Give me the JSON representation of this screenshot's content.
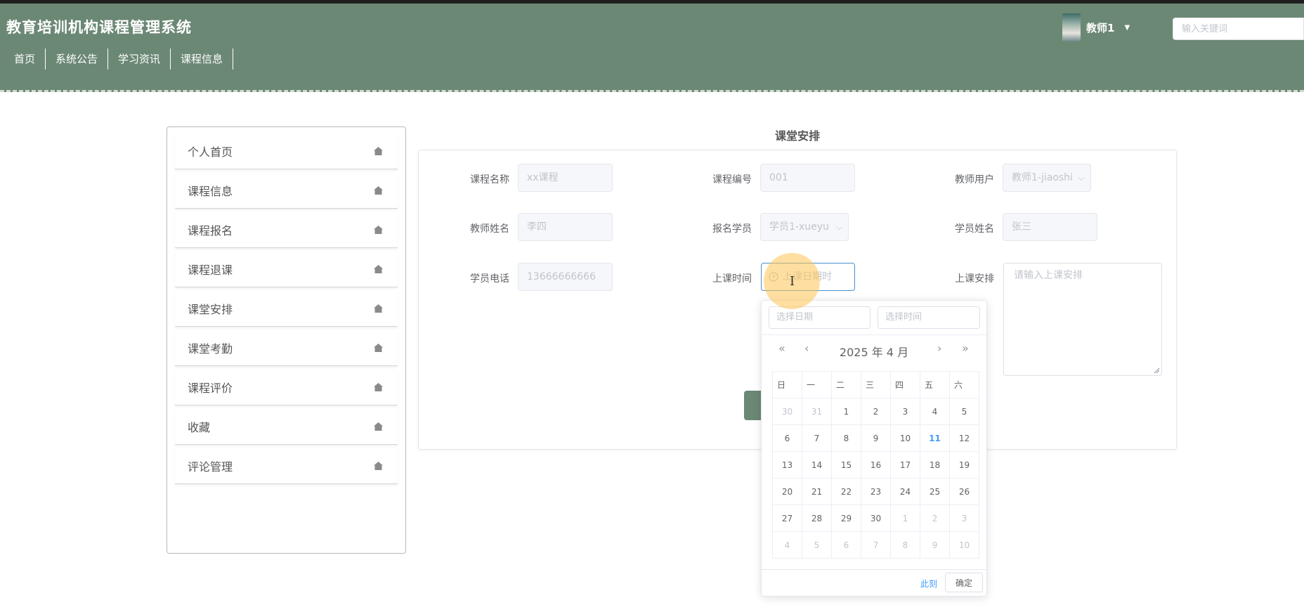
{
  "app": {
    "title": "教育培训机构课程管理系统"
  },
  "nav": [
    {
      "label": "首页"
    },
    {
      "label": "系统公告"
    },
    {
      "label": "学习资讯"
    },
    {
      "label": "课程信息"
    }
  ],
  "user": {
    "name": "教师1",
    "dropdown_icon": "caret-down-icon"
  },
  "search": {
    "placeholder": "输入关键词"
  },
  "sidebar": {
    "items": [
      {
        "label": "个人首页",
        "icon": "home-icon"
      },
      {
        "label": "课程信息",
        "icon": "home-icon"
      },
      {
        "label": "课程报名",
        "icon": "home-icon"
      },
      {
        "label": "课程退课",
        "icon": "home-icon"
      },
      {
        "label": "课堂安排",
        "icon": "home-icon"
      },
      {
        "label": "课堂考勤",
        "icon": "home-icon"
      },
      {
        "label": "课程评价",
        "icon": "home-icon"
      },
      {
        "label": "收藏",
        "icon": "home-icon"
      },
      {
        "label": "评论管理",
        "icon": "home-icon"
      }
    ]
  },
  "form": {
    "title": "课堂安排",
    "course_name": {
      "label": "课程名称",
      "value": "xx课程"
    },
    "course_no": {
      "label": "课程编号",
      "value": "001"
    },
    "teacher_user": {
      "label": "教师用户",
      "value": "教师1-jiaoshi"
    },
    "teacher_name": {
      "label": "教师姓名",
      "value": "李四"
    },
    "enrolled_student": {
      "label": "报名学员",
      "value": "学员1-xueyu"
    },
    "student_name": {
      "label": "学员姓名",
      "value": "张三"
    },
    "student_phone": {
      "label": "学员电话",
      "value": "13666666666"
    },
    "class_time": {
      "label": "上课时间",
      "placeholder": "上课日期时"
    },
    "schedule": {
      "label": "上课安排",
      "placeholder": "请输入上课安排"
    }
  },
  "datepicker": {
    "date_placeholder": "选择日期",
    "time_placeholder": "选择时间",
    "header": "2025 年  4 月",
    "weekdays": [
      "日",
      "一",
      "二",
      "三",
      "四",
      "五",
      "六"
    ],
    "weeks": [
      [
        "30",
        "31",
        "1",
        "2",
        "3",
        "4",
        "5"
      ],
      [
        "6",
        "7",
        "8",
        "9",
        "10",
        "11",
        "12"
      ],
      [
        "13",
        "14",
        "15",
        "16",
        "17",
        "18",
        "19"
      ],
      [
        "20",
        "21",
        "22",
        "23",
        "24",
        "25",
        "26"
      ],
      [
        "27",
        "28",
        "29",
        "30",
        "1",
        "2",
        "3"
      ],
      [
        "4",
        "5",
        "6",
        "7",
        "8",
        "9",
        "10"
      ]
    ],
    "today": "11",
    "now_label": "此刻",
    "confirm_label": "确定"
  },
  "colors": {
    "header_bg": "#6b8874",
    "accent": "#409eff",
    "focus_border": "#4a90c9"
  }
}
